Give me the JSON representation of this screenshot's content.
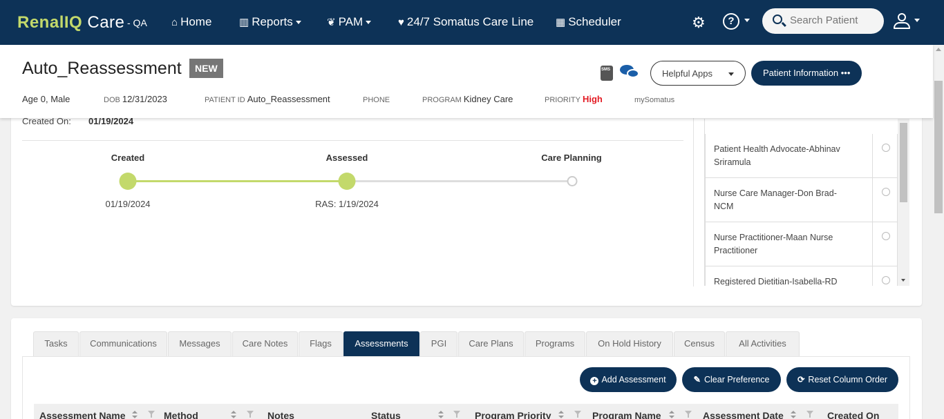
{
  "app": {
    "brand_renal": "Renal",
    "brand_iq": "IQ",
    "brand_care": " Care",
    "env": "- QA"
  },
  "nav": {
    "home": "Home",
    "reports": "Reports",
    "pam": "PAM",
    "care_line": "24/7 Somatus Care Line",
    "scheduler": "Scheduler",
    "help_glyph": "?",
    "search_placeholder": "Search Patient"
  },
  "patient": {
    "name": "Auto_Reassessment",
    "badge": "NEW",
    "sms_icon_text": "SMS",
    "helpful_apps": "Helpful Apps",
    "patient_info_button": "Patient Information •••",
    "age_sex": "Age 0, Male",
    "dob_label": "DOB",
    "dob": "12/31/2023",
    "patient_id_label": "PATIENT ID",
    "patient_id": "Auto_Reassessment",
    "phone_label": "PHONE",
    "program_label": "PROGRAM",
    "program": "Kidney Care",
    "priority_label": "PRIORITY",
    "priority": "High",
    "mysomatus": "mySomatus"
  },
  "assessment_card": {
    "created_on_label": "Created On:",
    "created_on": "01/19/2024",
    "stages": [
      {
        "label": "Created",
        "date": "01/19/2024",
        "done": true
      },
      {
        "label": "Assessed",
        "date": "RAS: 1/19/2024",
        "done": true
      },
      {
        "label": "Care Planning",
        "date": "",
        "done": false
      }
    ],
    "care_team": [
      {
        "name": "Patient Health Advocate-Abhinav Sriramula"
      },
      {
        "name": "Nurse Care Manager-Don Brad-NCM"
      },
      {
        "name": "Nurse Practitioner-Maan Nurse Practitioner"
      },
      {
        "name": "Registered Dietitian-Isabella-RD Dave"
      }
    ]
  },
  "tabs": [
    {
      "label": "Tasks",
      "active": false
    },
    {
      "label": "Communications",
      "active": false
    },
    {
      "label": "Messages",
      "active": false
    },
    {
      "label": "Care Notes",
      "active": false
    },
    {
      "label": "Flags",
      "active": false
    },
    {
      "label": "Assessments",
      "active": true
    },
    {
      "label": "PGI",
      "active": false
    },
    {
      "label": "Care Plans",
      "active": false
    },
    {
      "label": "Programs",
      "active": false
    },
    {
      "label": "On Hold History",
      "active": false
    },
    {
      "label": "Census",
      "active": false
    },
    {
      "label": "All Activities",
      "active": false
    }
  ],
  "assessments_panel": {
    "add_assessment": "Add Assessment",
    "clear_preference": "Clear Preference",
    "reset_column_order": "Reset Column Order",
    "columns": [
      "Assessment Name",
      "Method",
      "Notes",
      "Status",
      "Program Priority",
      "Program Name",
      "Assessment Date",
      "Created On"
    ]
  },
  "colors": {
    "nav_bg": "#0d3257",
    "brand_green": "#c3d96b",
    "priority_high": "#e31b23"
  }
}
